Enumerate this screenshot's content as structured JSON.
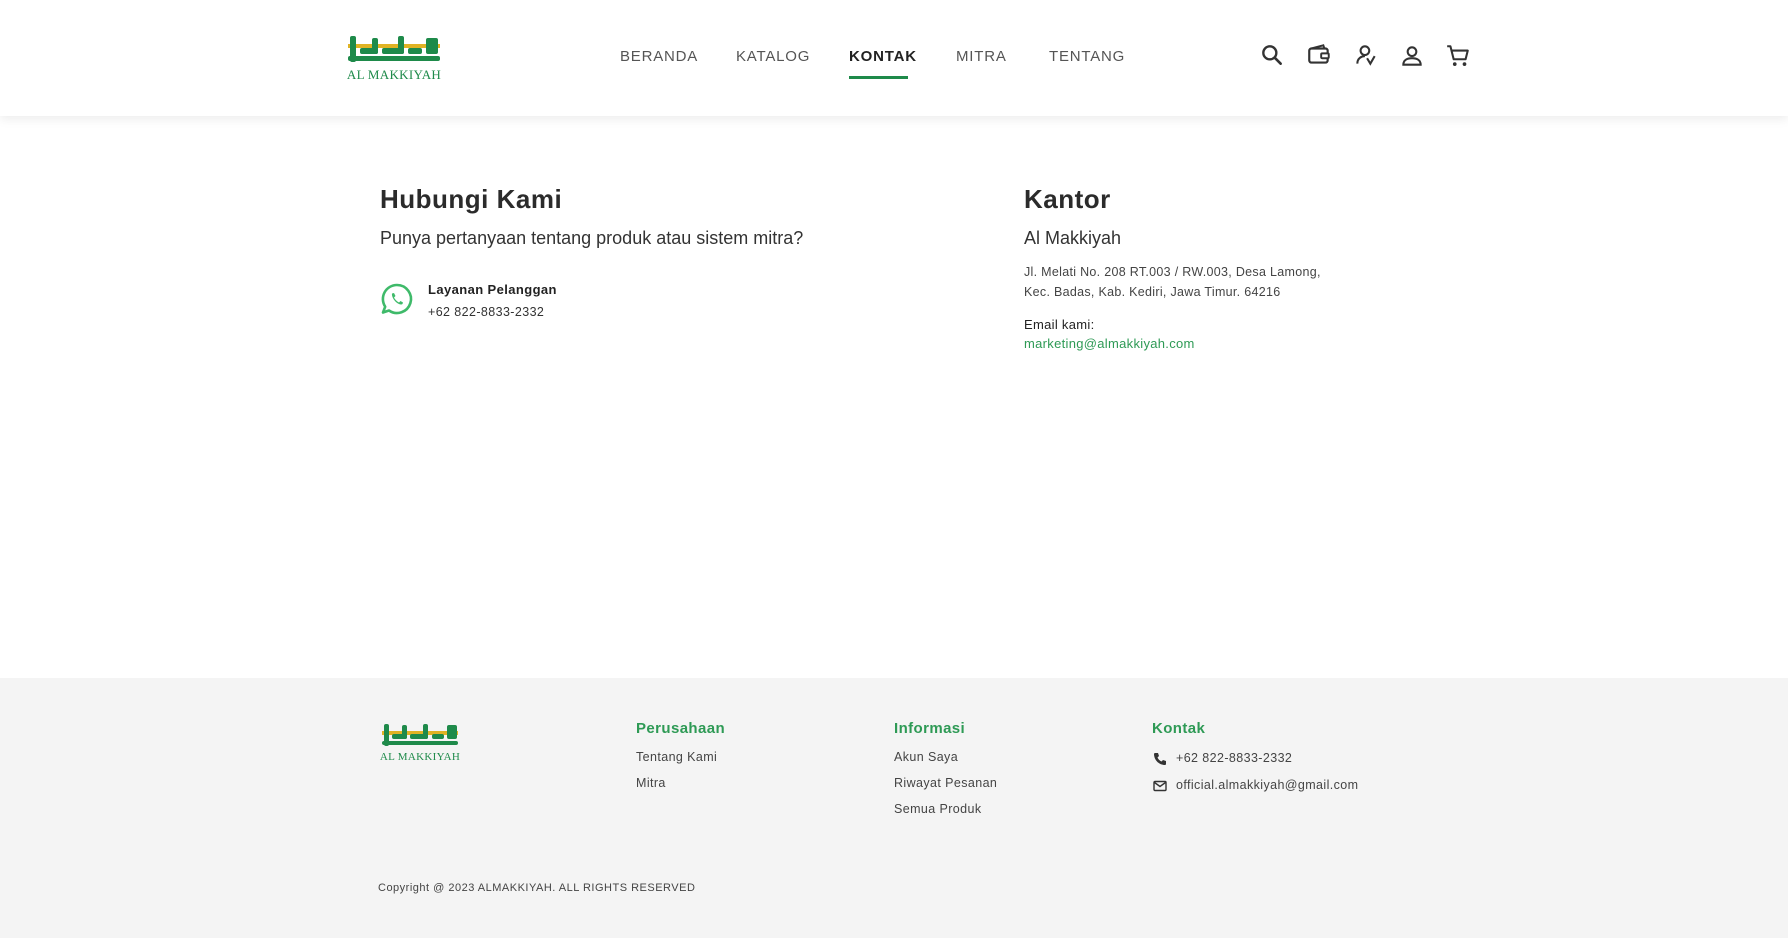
{
  "brand": {
    "logo_text": "AL MAKKIYAH",
    "primary_color": "#1e8a4a",
    "accent_color": "#e0b324"
  },
  "nav": {
    "items": [
      {
        "label": "BERANDA",
        "active": false
      },
      {
        "label": "KATALOG",
        "active": false
      },
      {
        "label": "KONTAK",
        "active": true
      },
      {
        "label": "MITRA",
        "active": false
      },
      {
        "label": "TENTANG",
        "active": false
      }
    ]
  },
  "header_icons": [
    "search-icon",
    "wallet-icon",
    "partner-icon",
    "user-icon",
    "cart-icon"
  ],
  "contact": {
    "title": "Hubungi Kami",
    "subtitle": "Punya pertanyaan tentang produk atau sistem mitra?",
    "service_label": "Layanan Pelanggan",
    "service_phone": "+62 822-8833-2332"
  },
  "office": {
    "title": "Kantor",
    "name": "Al Makkiyah",
    "address_line1": "Jl. Melati No. 208 RT.003 / RW.003, Desa Lamong,",
    "address_line2": "Kec. Badas, Kab. Kediri, Jawa Timur. 64216",
    "email_label": "Email kami:",
    "email": "marketing@almakkiyah.com"
  },
  "footer": {
    "company": {
      "title": "Perusahaan",
      "links": [
        "Tentang Kami",
        "Mitra"
      ]
    },
    "info": {
      "title": "Informasi",
      "links": [
        "Akun Saya",
        "Riwayat Pesanan",
        "Semua Produk"
      ]
    },
    "contact": {
      "title": "Kontak",
      "phone": "+62 822-8833-2332",
      "email": "official.almakkiyah@gmail.com"
    },
    "copyright": "Copyright @ 2023 ALMAKKIYAH.  ALL RIGHTS RESERVED"
  }
}
